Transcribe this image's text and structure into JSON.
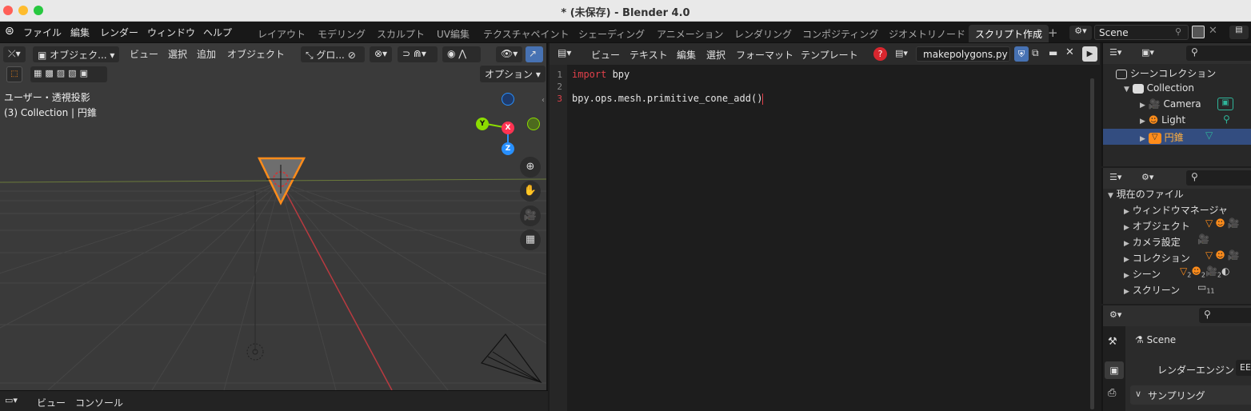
{
  "window": {
    "title": "* (未保存) - Blender 4.0"
  },
  "topbar": {
    "menus": [
      "ファイル",
      "編集",
      "レンダー",
      "ウィンドウ",
      "ヘルプ"
    ],
    "workspaces": [
      "レイアウト",
      "モデリング",
      "スカルプト",
      "UV編集",
      "テクスチャペイント",
      "シェーディング",
      "アニメーション",
      "レンダリング",
      "コンポジティング",
      "ジオメトリノード",
      "スクリプト作成"
    ],
    "active_workspace": "スクリプト作成",
    "add_tab": "+",
    "scene_name": "Scene"
  },
  "viewport": {
    "mode": "オブジェク...",
    "menus": [
      "ビュー",
      "選択",
      "追加",
      "オブジェクト"
    ],
    "transform": "グロ...",
    "options": "オプション",
    "view_name": "ユーザー・透視投影",
    "collection_info": "(3) Collection | 円錐",
    "gizmo": {
      "x": "X",
      "y": "Y",
      "z": "Z"
    }
  },
  "console": {
    "menus": [
      "ビュー",
      "コンソール"
    ]
  },
  "text_editor": {
    "menus": [
      "ビュー",
      "テキスト",
      "編集",
      "選択",
      "フォーマット",
      "テンプレート"
    ],
    "filename": "makepolygons.py",
    "lines": [
      {
        "num": "1",
        "keyword": "import",
        "rest": " bpy"
      },
      {
        "num": "2",
        "keyword": "",
        "rest": ""
      },
      {
        "num": "3",
        "keyword": "",
        "rest": "bpy.ops.mesh.primitive_cone_add()"
      }
    ]
  },
  "outliner": {
    "scene_collection": "シーンコレクション",
    "collection": "Collection",
    "items": [
      "Camera",
      "Light",
      "円錐"
    ]
  },
  "data_panel": {
    "root": "現在のファイル",
    "items": [
      "ウィンドウマネージャ",
      "オブジェクト",
      "カメラ設定",
      "コレクション",
      "シーン",
      "スクリーン"
    ],
    "scene_counts": [
      "2",
      "2",
      "2"
    ],
    "screen_count": "11"
  },
  "properties": {
    "scene": "Scene",
    "render_engine_label": "レンダーエンジン",
    "render_engine_value": "EE",
    "sampling": "サンプリング"
  },
  "colors": {
    "accent": "#ff8c1a",
    "x_axis": "#ff3352",
    "y_axis": "#8bdc00",
    "z_axis": "#2890ff",
    "keyword": "#e0404a"
  }
}
